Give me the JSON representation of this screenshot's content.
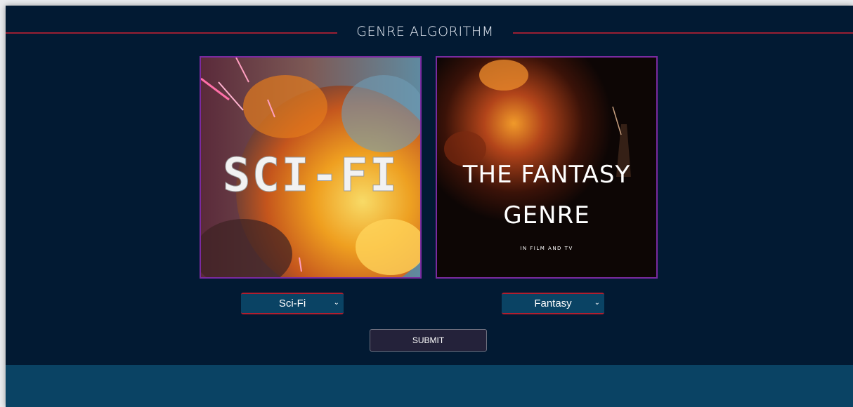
{
  "header": {
    "title": "GENRE ALGORITHM"
  },
  "cards": {
    "scifi": {
      "image_text": "SCI-FI"
    },
    "fantasy": {
      "line1": "THE FANTASY",
      "line2": "GENRE",
      "line3": "IN FILM AND TV"
    }
  },
  "selects": {
    "left": {
      "value": "Sci-Fi",
      "icon": "chevron-down-icon"
    },
    "right": {
      "value": "Fantasy",
      "icon": "chevron-down-icon"
    }
  },
  "submit": {
    "label": "SUBMIT"
  },
  "colors": {
    "background": "#021a33",
    "accent_line": "#9a1f33",
    "card_border": "#7a2aa0",
    "select_bg": "#0a4364",
    "select_border": "#b21e2e",
    "button_bg": "#24223a",
    "footer": "#0a4364"
  }
}
